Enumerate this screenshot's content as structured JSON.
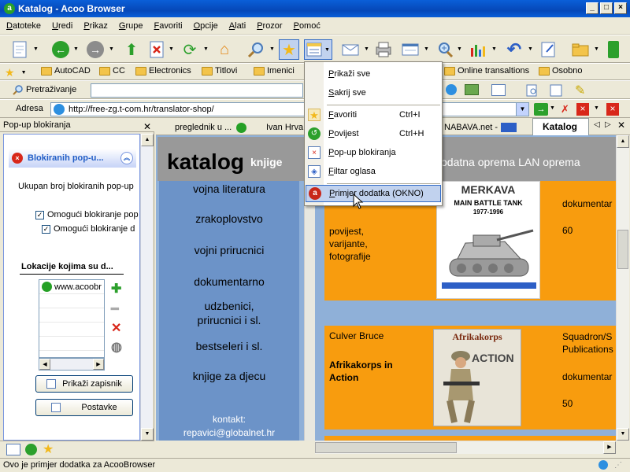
{
  "window": {
    "title": "Katalog - Acoo Browser",
    "controls": [
      "_",
      "□",
      "×"
    ]
  },
  "menu": [
    "Datoteke",
    "Uredi",
    "Prikaz",
    "Grupe",
    "Favoriti",
    "Opcije",
    "Alati",
    "Prozor",
    "Pomoć"
  ],
  "links": {
    "items": [
      "AutoCAD",
      "CC",
      "Electronics",
      "Titlovi",
      "Imenici",
      "Online transaltions",
      "Osobno"
    ]
  },
  "search": {
    "label": "Pretraživanje",
    "value": ""
  },
  "address": {
    "label": "Adresa",
    "url": "http://free-zg.t-com.hr/translator-shop/"
  },
  "sidebar": {
    "header": "Pop-up blokiranja",
    "panel_title": "Blokiranih pop-u...",
    "count_label": "Ukupan broj blokiranih pop-up",
    "checkbox1": "Omogući blokiranje pop",
    "checkbox2": "Omogući blokiranje d",
    "locations_header": "Lokacije kojima su d...",
    "locations": [
      "www.acoobr"
    ],
    "log_button": "Prikaži zapisnik",
    "settings_button": "Postavke"
  },
  "tabs": {
    "items": [
      "preglednik u ...",
      "Ivan Hrva",
      "NABAVA.net -"
    ],
    "active": "Katalog"
  },
  "favorites_menu": {
    "show_all": "Prikaži sve",
    "hide_all": "Sakrij sve",
    "favorites": "Favoriti",
    "favorites_shortcut": "Ctrl+I",
    "history": "Povijest",
    "history_shortcut": "Ctrl+H",
    "popup": "Pop-up blokiranja",
    "ad_filter": "Filtar oglasa",
    "plugin_example": "Primjer dodatka (OKNO)"
  },
  "page": {
    "brand": "katalog",
    "brand_sub": "knjige",
    "header_right": "odatna oprema LAN oprema",
    "categories": [
      "vojna literatura",
      "zrakoplovstvo",
      "vojni prirucnici",
      "dokumentarno",
      "udzbenici,\nprirucnici i sl.",
      "bestseleri i sl.",
      "knjige za djecu"
    ],
    "contact_label": "kontakt:",
    "contact_email": "repavici@globalnet.hr",
    "product1": {
      "left_text": "povijest,\nvarijante,\nfotografije",
      "right_type": "dokumentar",
      "right_pages": "60",
      "image_title": "MERKAVA",
      "image_sub": "MAIN BATTLE TANK",
      "image_years": "1977-1996"
    },
    "product2": {
      "author": "Culver Bruce",
      "title": "Afrikakorps in\nAction",
      "publisher": "Squadron/S\nPublications",
      "type": "dokumentar",
      "pages": "50",
      "image_title": "Afrikakorps",
      "image_sub": "ACTION"
    }
  },
  "status": {
    "text": "Ovo je primjer dodatka za AcooBrowser"
  },
  "colors": {
    "titlebar": "#0a5fd8",
    "menu_highlight": "#c1d2ee",
    "page_nav": "#6c93c8",
    "page_product": "#f89c0e",
    "page_header": "#999999"
  }
}
